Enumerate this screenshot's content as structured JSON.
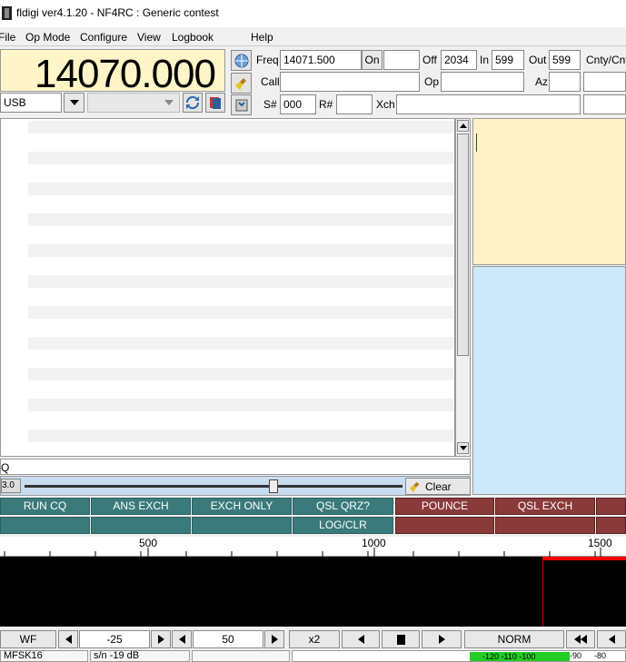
{
  "window": {
    "title": "fldigi ver4.1.20 - NF4RC : Generic contest"
  },
  "menu": [
    {
      "label": "File"
    },
    {
      "label": "Op Mode"
    },
    {
      "label": "Configure"
    },
    {
      "label": "View"
    },
    {
      "label": "Logbook"
    },
    {
      "label": "Help"
    }
  ],
  "frequency": {
    "display": "14070.000",
    "mode": "USB"
  },
  "log": {
    "freq_label": "Freq",
    "freq_value": "14071.500",
    "on_label": "On",
    "on_value": "",
    "off_label": "Off",
    "off_value": "2034",
    "in_label": "In",
    "in_value": "599",
    "out_label": "Out",
    "out_value": "599",
    "cnty_label": "Cnty/Cnt",
    "call_label": "Call",
    "call_value": "",
    "op_label": "Op",
    "op_value": "",
    "az_label": "Az",
    "az_value": "",
    "s_label": "S#",
    "s_value": "000",
    "r_label": "R#",
    "r_value": "",
    "xch_label": "Xch",
    "xch_value": ""
  },
  "tx": {
    "text": "Q",
    "squelch_value": "3.0",
    "clear_label": "Clear"
  },
  "macros": {
    "row1": [
      "RUN CQ",
      "ANS EXCH",
      "EXCH ONLY",
      "QSL QRZ?",
      "POUNCE",
      "QSL EXCH"
    ],
    "row2_log": "LOG/CLR"
  },
  "ruler": {
    "ticks": [
      "500",
      "1000",
      "1500"
    ]
  },
  "wf_controls": {
    "wf_label": "WF",
    "level1": "-25",
    "level2": "50",
    "zoom": "x2",
    "norm_label": "NORM"
  },
  "status": {
    "mode": "MFSK16",
    "sn": "s/n -19 dB",
    "meter_labels": [
      "-120",
      "-110",
      "-100"
    ],
    "scale_labels": [
      "-90",
      "-80"
    ]
  },
  "colors": {
    "freq_bg": "#fff5c8",
    "macro_teal": "#3a7a7a",
    "macro_red": "#8a3a3a",
    "panel_yellow": "#fff2c6",
    "panel_blue": "#cce8fb",
    "waterfall": "#000000",
    "cursor_red": "#ff0000"
  }
}
